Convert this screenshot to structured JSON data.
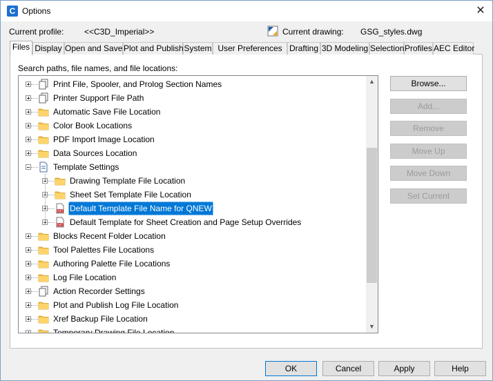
{
  "window": {
    "title": "Options",
    "close_glyph": "✕",
    "app_icon": "C"
  },
  "profile": {
    "current_profile_label": "Current profile:",
    "current_profile_value": "<<C3D_Imperial>>",
    "current_drawing_label": "Current drawing:",
    "current_drawing_value": "GSG_styles.dwg"
  },
  "tabs": [
    "Files",
    "Display",
    "Open and Save",
    "Plot and Publish",
    "System",
    "User Preferences",
    "Drafting",
    "3D Modeling",
    "Selection",
    "Profiles",
    "AEC Editor"
  ],
  "active_tab": "Files",
  "tree_caption": "Search paths, file names, and file locations:",
  "tree": [
    {
      "label": "Print File, Spooler, and Prolog Section Names",
      "icon": "files-icon",
      "level": 0,
      "expanded": false
    },
    {
      "label": "Printer Support File Path",
      "icon": "files-icon",
      "level": 0,
      "expanded": false
    },
    {
      "label": "Automatic Save File Location",
      "icon": "folder-icon",
      "level": 0,
      "expanded": false
    },
    {
      "label": "Color Book Locations",
      "icon": "folder-icon",
      "level": 0,
      "expanded": false
    },
    {
      "label": "PDF Import Image Location",
      "icon": "folder-icon",
      "level": 0,
      "expanded": false
    },
    {
      "label": "Data Sources Location",
      "icon": "folder-icon",
      "level": 0,
      "expanded": false
    },
    {
      "label": "Template Settings",
      "icon": "document-icon",
      "level": 0,
      "expanded": true
    },
    {
      "label": "Drawing Template File Location",
      "icon": "folder-icon",
      "level": 1,
      "expanded": false
    },
    {
      "label": "Sheet Set Template File Location",
      "icon": "folder-icon",
      "level": 1,
      "expanded": false
    },
    {
      "label": "Default Template File Name for QNEW",
      "icon": "dwt-file-icon",
      "level": 1,
      "expanded": false,
      "selected": true
    },
    {
      "label": "Default Template for Sheet Creation and Page Setup Overrides",
      "icon": "dwt-file-icon",
      "level": 1,
      "expanded": false
    },
    {
      "label": "Blocks Recent Folder Location",
      "icon": "folder-icon",
      "level": 0,
      "expanded": false
    },
    {
      "label": "Tool Palettes File Locations",
      "icon": "folder-icon",
      "level": 0,
      "expanded": false
    },
    {
      "label": "Authoring Palette File Locations",
      "icon": "folder-icon",
      "level": 0,
      "expanded": false
    },
    {
      "label": "Log File Location",
      "icon": "folder-icon",
      "level": 0,
      "expanded": false
    },
    {
      "label": "Action Recorder Settings",
      "icon": "files-icon",
      "level": 0,
      "expanded": false
    },
    {
      "label": "Plot and Publish Log File Location",
      "icon": "folder-icon",
      "level": 0,
      "expanded": false
    },
    {
      "label": "Xref Backup File Location",
      "icon": "folder-icon",
      "level": 0,
      "expanded": false
    },
    {
      "label": "Temporary Drawing File Location",
      "icon": "folder-icon",
      "level": 0,
      "expanded": false
    }
  ],
  "side_buttons": [
    {
      "label": "Browse...",
      "enabled": true
    },
    {
      "label": "Add...",
      "enabled": false
    },
    {
      "label": "Remove",
      "enabled": false
    },
    {
      "label": "Move Up",
      "enabled": false
    },
    {
      "label": "Move Down",
      "enabled": false
    },
    {
      "label": "Set Current",
      "enabled": false
    }
  ],
  "footer_buttons": [
    {
      "label": "OK",
      "focused": true
    },
    {
      "label": "Cancel"
    },
    {
      "label": "Apply"
    },
    {
      "label": "Help"
    }
  ],
  "colors": {
    "selection": "#0078d7",
    "folder": "#f7bf3d",
    "accent": "#1c6fd1"
  }
}
